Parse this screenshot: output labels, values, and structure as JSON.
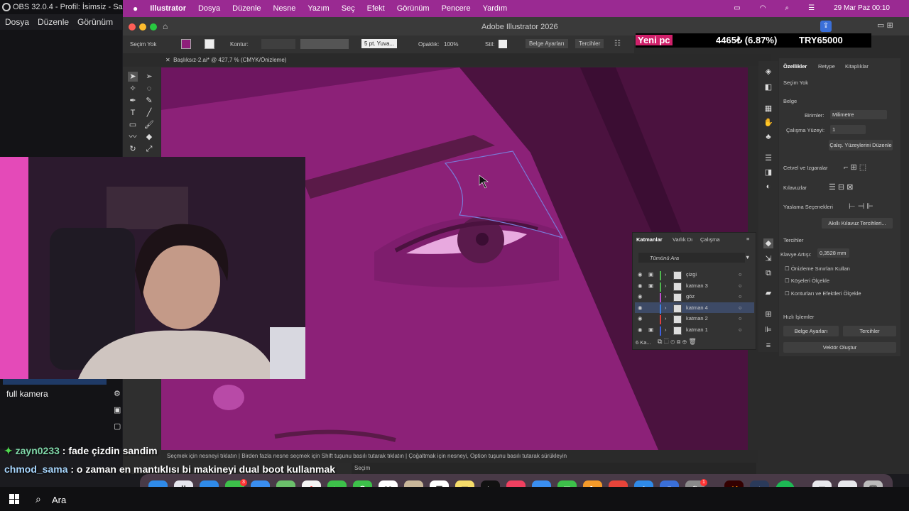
{
  "obs": {
    "title": "OBS 32.0.4 - Profil: İsimsiz - Sahnele",
    "menu": [
      "Dosya",
      "Düzenle",
      "Görünüm",
      "P"
    ],
    "scene_item": "full kamera",
    "search_label": "Ara"
  },
  "mac": {
    "app_menu": [
      "Illustrator",
      "Dosya",
      "Düzenle",
      "Nesne",
      "Yazım",
      "Seç",
      "Efekt",
      "Görünüm",
      "Pencere",
      "Yardım"
    ],
    "clock": "29 Mar Paz  00:10"
  },
  "illustrator": {
    "window_title": "Adobe Illustrator 2026",
    "control": {
      "selection": "Seçim Yok",
      "stroke_label": "Kontur:",
      "brush": "5 pt. Yuva...",
      "opacity_label": "Opaklık:",
      "opacity_value": "100%",
      "style_label": "Stil:",
      "doc_settings": "Belge Ayarları",
      "prefs": "Tercihler"
    },
    "tab": "Başlıksız-2.ai* @ 427,7 % (CMYK/Önizleme)",
    "status": "Seçmek için nesneyi tıklatın  |  Birden fazla nesne seçmek için Shift tuşunu basılı tutarak tıklatın  |  Çoğaltmak için nesneyi, Option tuşunu basılı tutarak sürükleyin",
    "status_tool": "Seçim",
    "properties": {
      "tabs": [
        "Özellikler",
        "Retype",
        "Kitaplıklar"
      ],
      "no_selection": "Seçim Yok",
      "document": "Belge",
      "units_label": "Birimler:",
      "units_value": "Milimetre",
      "artboard_label": "Çalışma Yüzeyi:",
      "artboard_value": "1",
      "artboard_button": "Çalış. Yüzeylerini Düzenle",
      "rulers_grids": "Cetvel ve Izgaralar",
      "guides": "Kılavuzlar",
      "snap_options": "Yaslama Seçenekleri",
      "smart_guides_button": "Akıllı Kılavuz Tercihleri...",
      "prefs_heading": "Tercihler",
      "keyboard_increment_label": "Klavye Artışı:",
      "keyboard_increment_value": "0,3528 mm",
      "checkboxes": [
        "Önizleme Sınırları Kullan",
        "Köşeleri Ölçekle",
        "Konturları ve Efektleri Ölçekle"
      ],
      "quick_actions": "Hızlı İşlemler",
      "doc_settings_button": "Belge Ayarları",
      "prefs_button": "Tercihler",
      "vector_button": "Vektör Oluştur"
    },
    "layers": {
      "tabs": [
        "Katmanlar",
        "Varlık Dı",
        "Çalışma"
      ],
      "search_placeholder": "Tümünü Ara",
      "rows": [
        {
          "name": "çizgi",
          "color": "#4fb84f",
          "locked": true
        },
        {
          "name": "katman 3",
          "color": "#4fb84f",
          "locked": true
        },
        {
          "name": "göz",
          "color": "#c04fd0",
          "locked": false
        },
        {
          "name": "katman 4",
          "color": "#3f7fe0",
          "locked": false
        },
        {
          "name": "katman 2",
          "color": "#e04040",
          "locked": false
        },
        {
          "name": "katman 1",
          "color": "#3f5fe0",
          "locked": true
        }
      ],
      "footer_count": "6 Ka..."
    }
  },
  "overlay": {
    "price_label": "Yeni pc",
    "price_change": "4465₺ (6.87%)",
    "price_target": "TRY65000"
  },
  "chat": [
    {
      "user": "zayn0233",
      "message": " : fade çizdin sandim",
      "user_color": "#7fd7a8"
    },
    {
      "user": "chmod_sama",
      "message": " : o zaman en mantıklısı bi makineyi dual boot kullanmak",
      "user_color": "#a8d7ff"
    }
  ],
  "dock": {
    "calendar_day": "29",
    "tv_label": "tv",
    "ai_label": "Ai",
    "badge_messages": "3",
    "badge_settings": "1"
  }
}
